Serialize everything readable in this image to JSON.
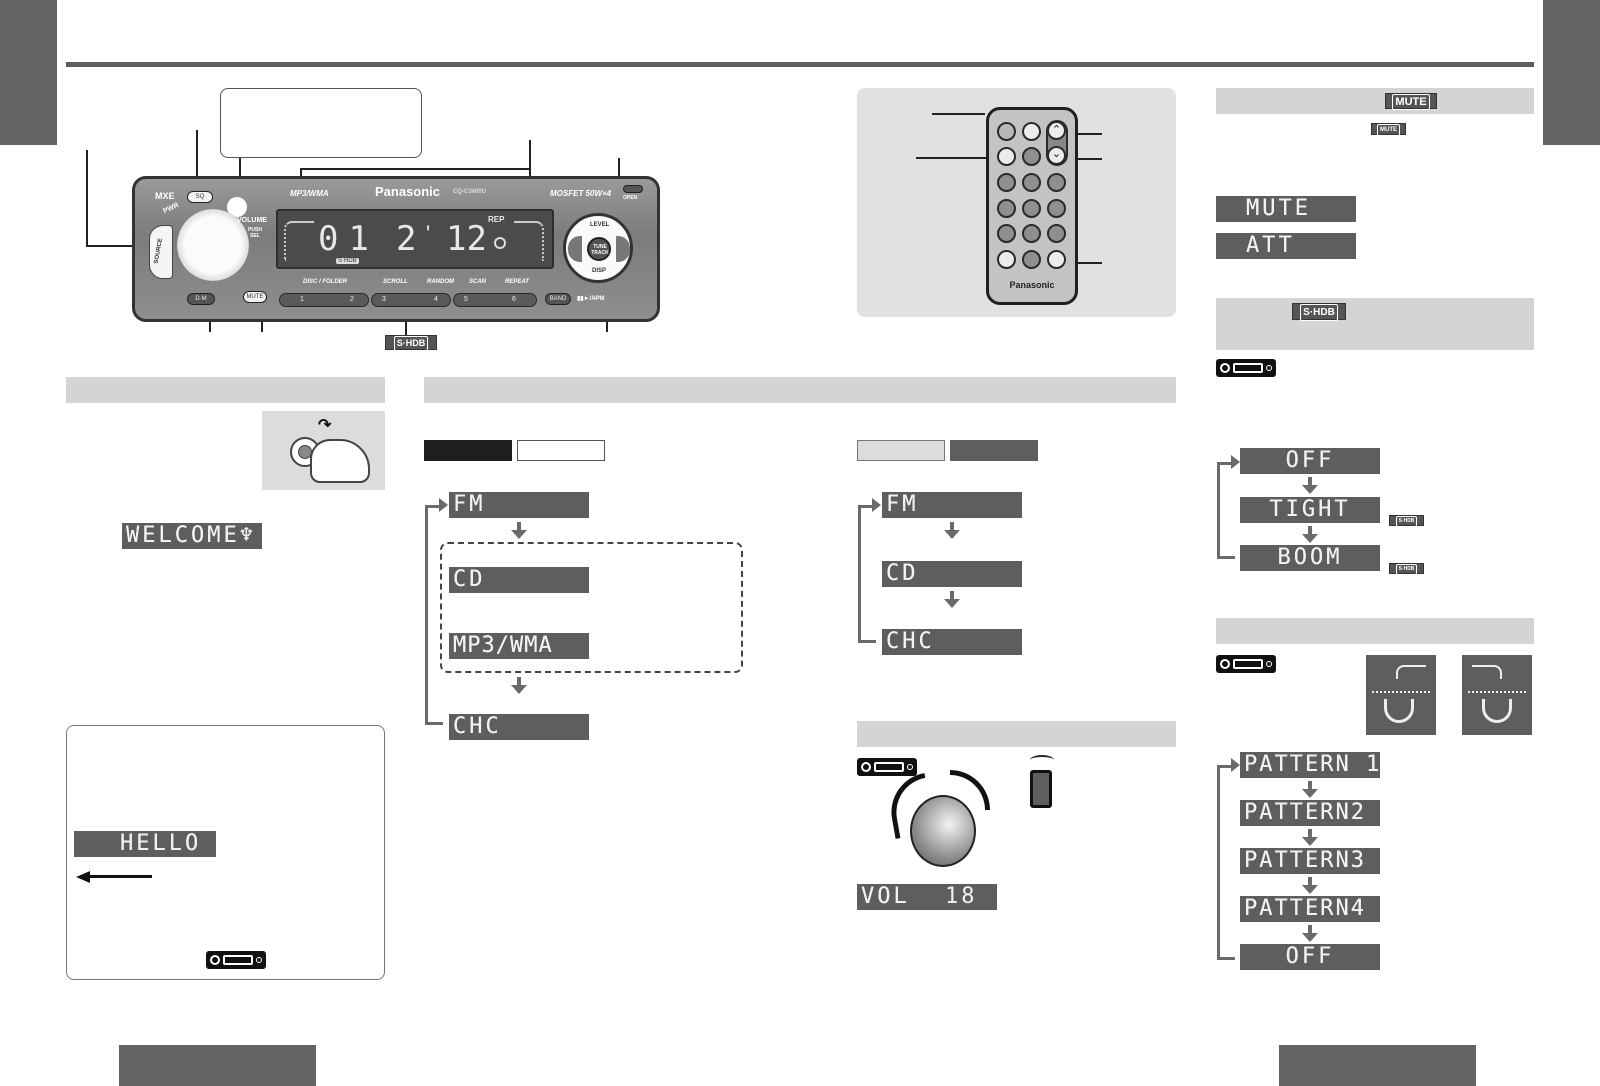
{
  "page": {
    "side_tabs": [
      "left",
      "right"
    ],
    "footer_tabs": [
      "left",
      "right"
    ]
  },
  "head_unit": {
    "brand": "Panasonic",
    "model": "CQ-C3400U",
    "logo_left": "MXE",
    "format_label": "MP3/WMA",
    "power_label": "MOSFET 50W×4",
    "open_label": "OPEN",
    "pwr_label": "PWR",
    "source_label": "SOURCE",
    "sq_label": "SQ",
    "volume_label": "VOLUME",
    "push_sel_label": "PUSH SEL",
    "dm_label": "D·M",
    "mute_label": "MUTE",
    "band_label": "BAND",
    "play_label": "▮▮►/APM",
    "level_label": "LEVEL",
    "disp_label": "DISP",
    "tune_track_label": "TUNE TRACK",
    "display": {
      "left_digits": "01",
      "right_digits": "2",
      "sep": "'",
      "track": "12",
      "rep_label": "REP",
      "shdb_tag": "S·HDB"
    },
    "preset_labels": [
      "DISC / FOLDER",
      "SCROLL",
      "RANDOM",
      "SCAN",
      "REPEAT"
    ],
    "preset_numbers": [
      "1",
      "2",
      "3",
      "4",
      "5",
      "6"
    ],
    "callout_badge": "S·HDB"
  },
  "remote": {
    "brand": "Panasonic"
  },
  "mute_section": {
    "header_badge": "MUTE",
    "inline_badge": "MUTE",
    "displays": [
      "MUTE",
      "ATT"
    ]
  },
  "shdb_section": {
    "header_badge": "S·HDB",
    "cycle": [
      "OFF",
      "TIGHT",
      "BOOM"
    ],
    "cycle_badges": [
      "",
      "S·HDB",
      "S·HDB"
    ]
  },
  "pattern_section": {
    "cycle": [
      "PATTERN 1",
      "PATTERN2",
      "PATTERN3",
      "PATTERN4",
      "OFF"
    ]
  },
  "power_section": {
    "display": "WELCOME♆"
  },
  "note_box": {
    "display": "HELLO"
  },
  "source_section": {
    "cycle_left": [
      "FM",
      "CD",
      "MP3/WMA",
      "CHC"
    ],
    "cycle_right": [
      "FM",
      "CD",
      "CHC"
    ]
  },
  "volume_section": {
    "display_label": "VOL",
    "display_value": "18"
  }
}
